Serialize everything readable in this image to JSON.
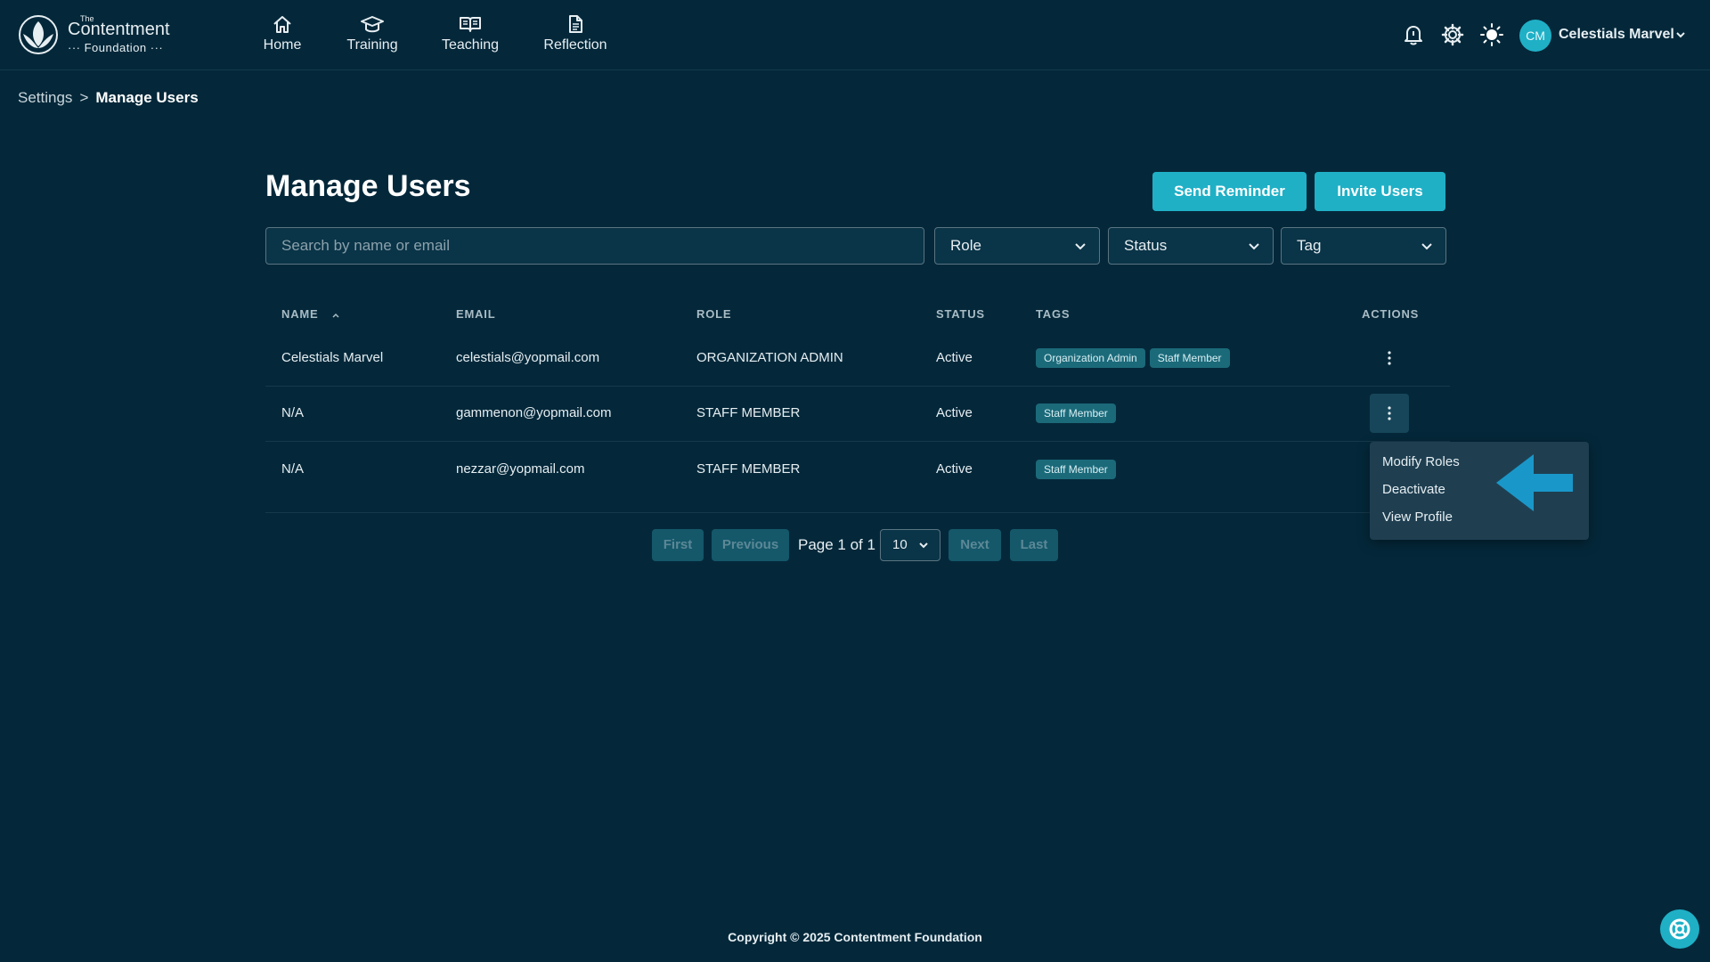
{
  "brand": {
    "line1": "The",
    "line2": "Contentment",
    "line3": "··· Foundation ···"
  },
  "nav": [
    {
      "label": "Home",
      "icon": "home-icon"
    },
    {
      "label": "Training",
      "icon": "graduation-cap-icon"
    },
    {
      "label": "Teaching",
      "icon": "book-icon"
    },
    {
      "label": "Reflection",
      "icon": "document-icon"
    }
  ],
  "header": {
    "icons": [
      "bell-icon",
      "gear-icon",
      "sun-icon"
    ],
    "avatar_initials": "CM",
    "user_name": "Celestials Marvel"
  },
  "breadcrumb": {
    "parent": "Settings",
    "separator": ">",
    "current": "Manage Users"
  },
  "page": {
    "title": "Manage Users",
    "send_reminder": "Send Reminder",
    "invite_users": "Invite Users"
  },
  "filters": {
    "search_placeholder": "Search by name or email",
    "role": "Role",
    "status": "Status",
    "tag": "Tag"
  },
  "table": {
    "columns": [
      "NAME",
      "EMAIL",
      "ROLE",
      "STATUS",
      "TAGS",
      "ACTIONS"
    ],
    "sort_column": "NAME",
    "sort_direction": "ascending",
    "rows": [
      {
        "name": "Celestials Marvel",
        "email": "celestials@yopmail.com",
        "role": "ORGANIZATION ADMIN",
        "status": "Active",
        "tags": [
          "Organization Admin",
          "Staff Member"
        ]
      },
      {
        "name": "N/A",
        "email": "gammenon@yopmail.com",
        "role": "STAFF MEMBER",
        "status": "Active",
        "tags": [
          "Staff Member"
        ]
      },
      {
        "name": "N/A",
        "email": "nezzar@yopmail.com",
        "role": "STAFF MEMBER",
        "status": "Active",
        "tags": [
          "Staff Member"
        ]
      }
    ]
  },
  "pagination": {
    "first": "First",
    "previous": "Previous",
    "page_text": "Page 1 of 1",
    "page_size": "10",
    "next": "Next",
    "last": "Last"
  },
  "actions_menu": {
    "items": [
      "Modify Roles",
      "Deactivate",
      "View Profile"
    ]
  },
  "footer": {
    "copyright": "Copyright © 2025 Contentment Foundation"
  },
  "colors": {
    "background": "#04283a",
    "accent": "#1fb0c6",
    "tag": "#1b6a7a",
    "menu": "#1f3f51",
    "annotation_arrow": "#1a97c9"
  }
}
